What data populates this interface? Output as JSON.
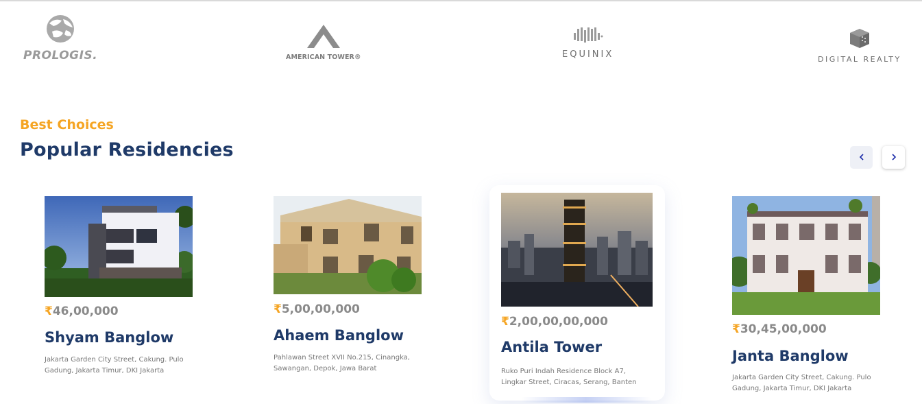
{
  "partners": [
    {
      "name": "PROLOGIS.",
      "icon": "globe-icon"
    },
    {
      "name": "AMERICAN TOWER®",
      "icon": "tower-icon"
    },
    {
      "name": "EQUINIX",
      "icon": "equinix-mark-icon"
    },
    {
      "name": "DIGITAL REALTY",
      "icon": "cube-icon"
    }
  ],
  "section": {
    "eyebrow": "Best Choices",
    "title": "Popular Residencies"
  },
  "nav": {
    "prev_symbol": "‹",
    "next_symbol": "›"
  },
  "colors": {
    "accent": "#f5a524",
    "heading": "#1f3a68",
    "price_text": "#8a8a8a"
  },
  "residencies": [
    {
      "currency": "₹",
      "price": "46,00,000",
      "name": "Shyam Banglow",
      "address": "Jakarta Garden City Street, Cakung. Pulo Gadung, Jakarta Timur, DKI Jakarta"
    },
    {
      "currency": "₹",
      "price": "5,00,00,000",
      "name": "Ahaem Banglow",
      "address": "Pahlawan Street XVII No.215, Cinangka, Sawangan, Depok, Jawa Barat"
    },
    {
      "currency": "₹",
      "price": "2,00,00,00,000",
      "name": "Antila Tower",
      "address": "Ruko Puri Indah Residence Block A7, Lingkar Street, Ciracas, Serang, Banten"
    },
    {
      "currency": "₹",
      "price": "30,45,00,000",
      "name": "Janta Banglow",
      "address": "Jakarta Garden City Street, Cakung. Pulo Gadung, Jakarta Timur, DKI Jakarta"
    }
  ]
}
